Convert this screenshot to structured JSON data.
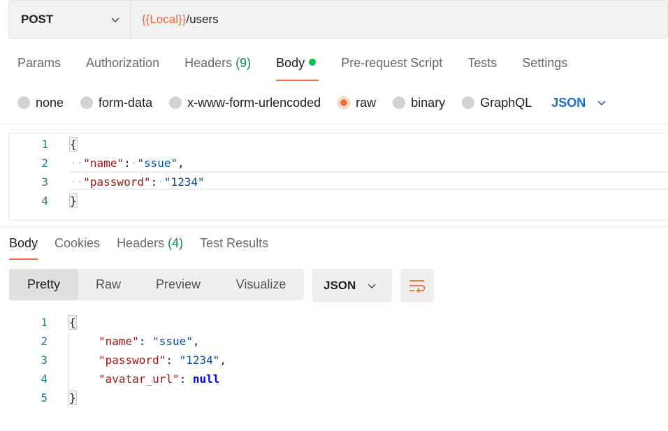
{
  "request": {
    "method": "POST",
    "url_variable": "{{Local}}",
    "url_path": "/users"
  },
  "request_tabs": [
    {
      "label": "Params"
    },
    {
      "label": "Authorization"
    },
    {
      "label": "Headers",
      "count": "(9)"
    },
    {
      "label": "Body"
    },
    {
      "label": "Pre-request Script"
    },
    {
      "label": "Tests"
    },
    {
      "label": "Settings"
    }
  ],
  "body_types": [
    "none",
    "form-data",
    "x-www-form-urlencoded",
    "raw",
    "binary",
    "GraphQL"
  ],
  "selected_body_type": "raw",
  "raw_format": "JSON",
  "request_body_lines": {
    "l1": {
      "num": "1",
      "open": "{"
    },
    "l2": {
      "num": "2",
      "key": "\"name\"",
      "colon": ":",
      "value": "\"ssue\"",
      "trail": ","
    },
    "l3": {
      "num": "3",
      "key": "\"password\"",
      "colon": ":",
      "value": "\"1234\""
    },
    "l4": {
      "num": "4",
      "close": "}"
    }
  },
  "response_tabs": [
    {
      "label": "Body"
    },
    {
      "label": "Cookies"
    },
    {
      "label": "Headers",
      "count": "(4)"
    },
    {
      "label": "Test Results"
    }
  ],
  "view_modes": [
    "Pretty",
    "Raw",
    "Preview",
    "Visualize"
  ],
  "response_format": "JSON",
  "response_body_lines": {
    "l1": {
      "num": "1",
      "open": "{"
    },
    "l2": {
      "num": "2",
      "key": "\"name\"",
      "value": "\"ssue\"",
      "trail": ","
    },
    "l3": {
      "num": "3",
      "key": "\"password\"",
      "value": "\"1234\"",
      "trail": ","
    },
    "l4": {
      "num": "4",
      "key": "\"avatar_url\"",
      "value": "null"
    },
    "l5": {
      "num": "5",
      "close": "}"
    }
  },
  "colors": {
    "accent": "#f26b3a",
    "link_blue": "#1c6fd1",
    "count_green": "#0f8a4c"
  }
}
